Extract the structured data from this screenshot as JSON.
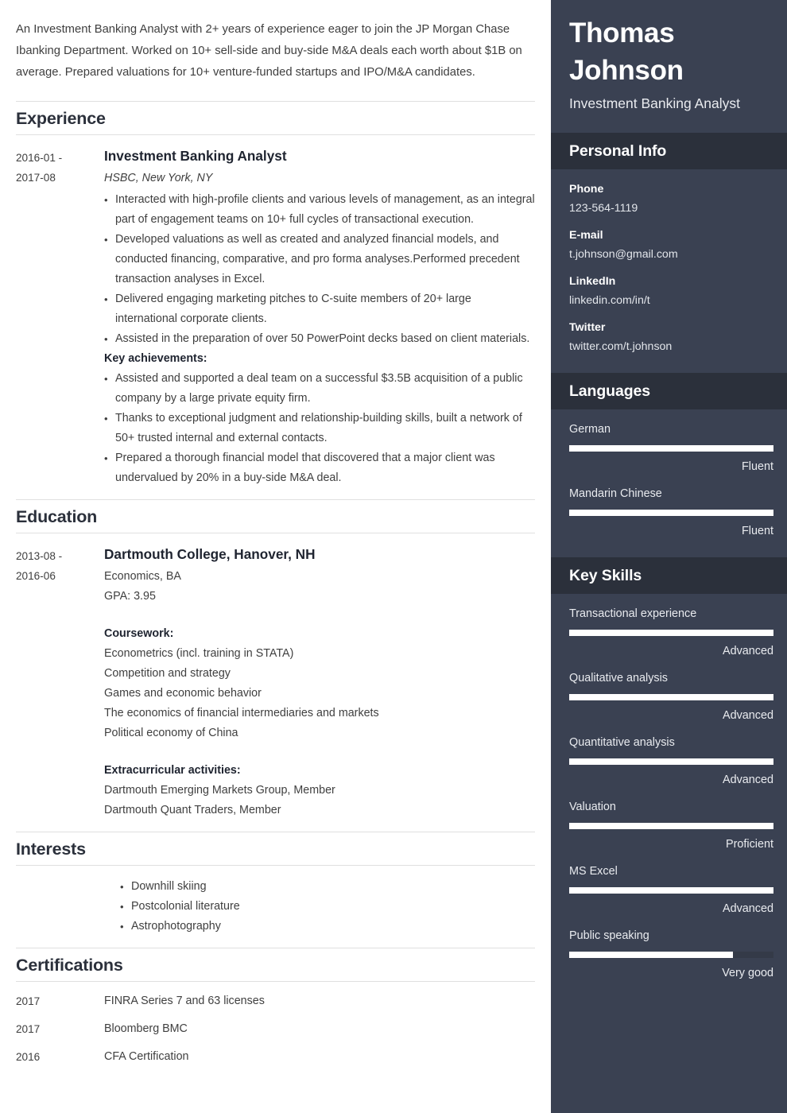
{
  "summary": "An Investment Banking Analyst with 2+ years of experience eager to join the JP Morgan Chase Ibanking Department. Worked on 10+ sell-side and buy-side M&A deals each worth about $1B on average. Prepared valuations for 10+ venture-funded startups and IPO/M&A candidates.",
  "sections": {
    "experience": {
      "title": "Experience",
      "entry": {
        "dates": "2016-01 - 2017-08",
        "date_start": "2016-01 -",
        "date_end": "2017-08",
        "job_title": "Investment Banking Analyst",
        "company": "HSBC, New York, NY",
        "bullets": [
          "Interacted with high-profile clients and various levels of management, as an integral part of engagement teams on 10+ full cycles of transactional execution.",
          "Developed valuations as well as created and analyzed financial models, and conducted financing, comparative, and pro forma analyses.Performed precedent transaction analyses in Excel.",
          "Delivered engaging marketing pitches to C-suite members of 20+ large international corporate clients.",
          "Assisted in the preparation of over 50 PowerPoint decks based on client materials."
        ],
        "achievements_label": "Key achievements:",
        "achievements": [
          "Assisted and supported a deal team on a successful $3.5B acquisition of a public company by a large private equity firm.",
          "Thanks to exceptional judgment and relationship-building skills, built a network of 50+ trusted internal and external contacts.",
          "Prepared a thorough financial model that discovered that a major client was undervalued by 20% in a buy-side M&A deal."
        ]
      }
    },
    "education": {
      "title": "Education",
      "entry": {
        "date_start": "2013-08 -",
        "date_end": "2016-06",
        "school": "Dartmouth College, Hanover, NH",
        "degree": "Economics, BA",
        "gpa": "GPA: 3.95",
        "coursework_label": "Coursework:",
        "coursework": [
          "Econometrics (incl. training in STATA)",
          "Competition and strategy",
          "Games and economic behavior",
          "The economics of financial intermediaries and markets",
          "Political economy of China"
        ],
        "extracurricular_label": "Extracurricular activities:",
        "extracurricular": [
          "Dartmouth Emerging Markets Group, Member",
          "Dartmouth Quant Traders, Member"
        ]
      }
    },
    "interests": {
      "title": "Interests",
      "items": [
        "Downhill skiing",
        "Postcolonial literature",
        "Astrophotography"
      ]
    },
    "certifications": {
      "title": "Certifications",
      "items": [
        {
          "year": "2017",
          "name": "FINRA Series 7 and 63 licenses"
        },
        {
          "year": "2017",
          "name": "Bloomberg BMC"
        },
        {
          "year": "2016",
          "name": "CFA Certification"
        }
      ]
    }
  },
  "sidebar": {
    "name": "Thomas Johnson",
    "role": "Investment Banking Analyst",
    "personal_info": {
      "title": "Personal Info",
      "fields": [
        {
          "label": "Phone",
          "value": "123-564-1119"
        },
        {
          "label": "E-mail",
          "value": "t.johnson@gmail.com"
        },
        {
          "label": "LinkedIn",
          "value": "linkedin.com/in/t"
        },
        {
          "label": "Twitter",
          "value": "twitter.com/t.johnson"
        }
      ]
    },
    "languages": {
      "title": "Languages",
      "items": [
        {
          "name": "German",
          "level": "Fluent",
          "percent": 100
        },
        {
          "name": "Mandarin Chinese",
          "level": "Fluent",
          "percent": 100
        }
      ]
    },
    "key_skills": {
      "title": "Key Skills",
      "items": [
        {
          "name": "Transactional experience",
          "level": "Advanced",
          "percent": 100
        },
        {
          "name": "Qualitative analysis",
          "level": "Advanced",
          "percent": 100
        },
        {
          "name": "Quantitative analysis",
          "level": "Advanced",
          "percent": 100
        },
        {
          "name": "Valuation",
          "level": "Proficient",
          "percent": 100
        },
        {
          "name": "MS Excel",
          "level": "Advanced",
          "percent": 100
        },
        {
          "name": "Public speaking",
          "level": "Very good",
          "percent": 80
        }
      ]
    },
    "colors": {
      "sidebar_background": "#3a4152",
      "section_header_background": "#2b303b",
      "bar_fill": "#ffffff",
      "bar_track": "#343a48"
    }
  }
}
